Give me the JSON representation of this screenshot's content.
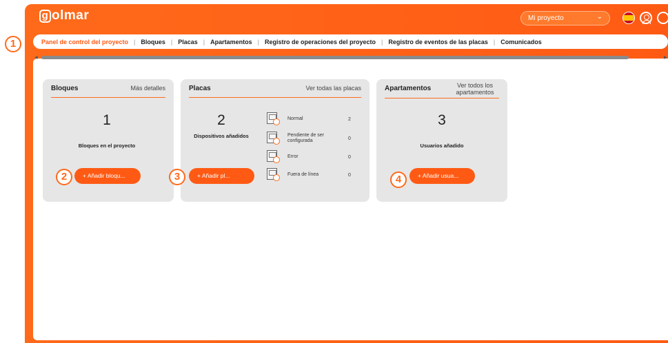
{
  "header": {
    "logo_text": "olmar",
    "logo_letter": "g",
    "project_select": "Mi proyecto",
    "icons": [
      "flag-es-icon",
      "user-icon",
      "support-icon"
    ]
  },
  "tabs": [
    {
      "label": "Panel de control del proyecto",
      "active": true
    },
    {
      "label": "Bloques"
    },
    {
      "label": "Placas"
    },
    {
      "label": "Apartamentos"
    },
    {
      "label": "Registro de operaciones del proyecto"
    },
    {
      "label": "Registro de eventos de las placas"
    },
    {
      "label": "Comunicados"
    }
  ],
  "callouts": [
    "1",
    "2",
    "3",
    "4"
  ],
  "cards": {
    "bloques": {
      "title": "Bloques",
      "link": "Más detalles",
      "count": "1",
      "desc": "Bloques en el proyecto",
      "button": "+ Añadir bloqu..."
    },
    "placas": {
      "title": "Placas",
      "link": "Ver todas las placas",
      "count": "2",
      "desc": "Dispositivos añadidos",
      "button": "+ Añadir pl...",
      "statuses": [
        {
          "label": "Normal",
          "count": "2"
        },
        {
          "label": "Pendiente de ser configurada",
          "count": "0"
        },
        {
          "label": "Error",
          "count": "0"
        },
        {
          "label": "Fuera de línea",
          "count": "0"
        }
      ]
    },
    "apartamentos": {
      "title": "Apartamentos",
      "link": "Ver todos los apartamentos",
      "count": "3",
      "desc": "Usuarios añadido",
      "button": "+ Añadir usua..."
    }
  },
  "colors": {
    "accent": "#ff5a14",
    "card_bg": "#e6e6e6"
  }
}
